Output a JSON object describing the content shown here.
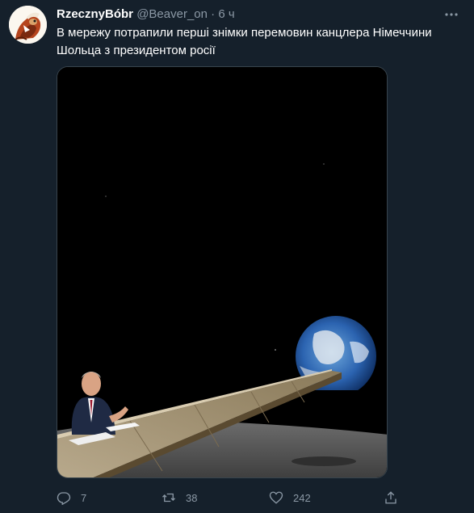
{
  "tweet": {
    "display_name": "RzecznyBóbr",
    "handle": "@Beaver_on",
    "separator": "·",
    "time": "6 ч",
    "text": "В мережу потрапили перші знімки перемовин канцлера Німеччини Шольца з президентом росії",
    "more_icon": "more-dots-icon"
  },
  "actions": {
    "reply_count": "7",
    "retweet_count": "38",
    "like_count": "242",
    "icons": [
      "reply-icon",
      "retweet-icon",
      "like-icon",
      "share-icon"
    ]
  },
  "colors": {
    "background": "#15202b",
    "muted": "#8b98a5",
    "text": "#ffffff"
  }
}
